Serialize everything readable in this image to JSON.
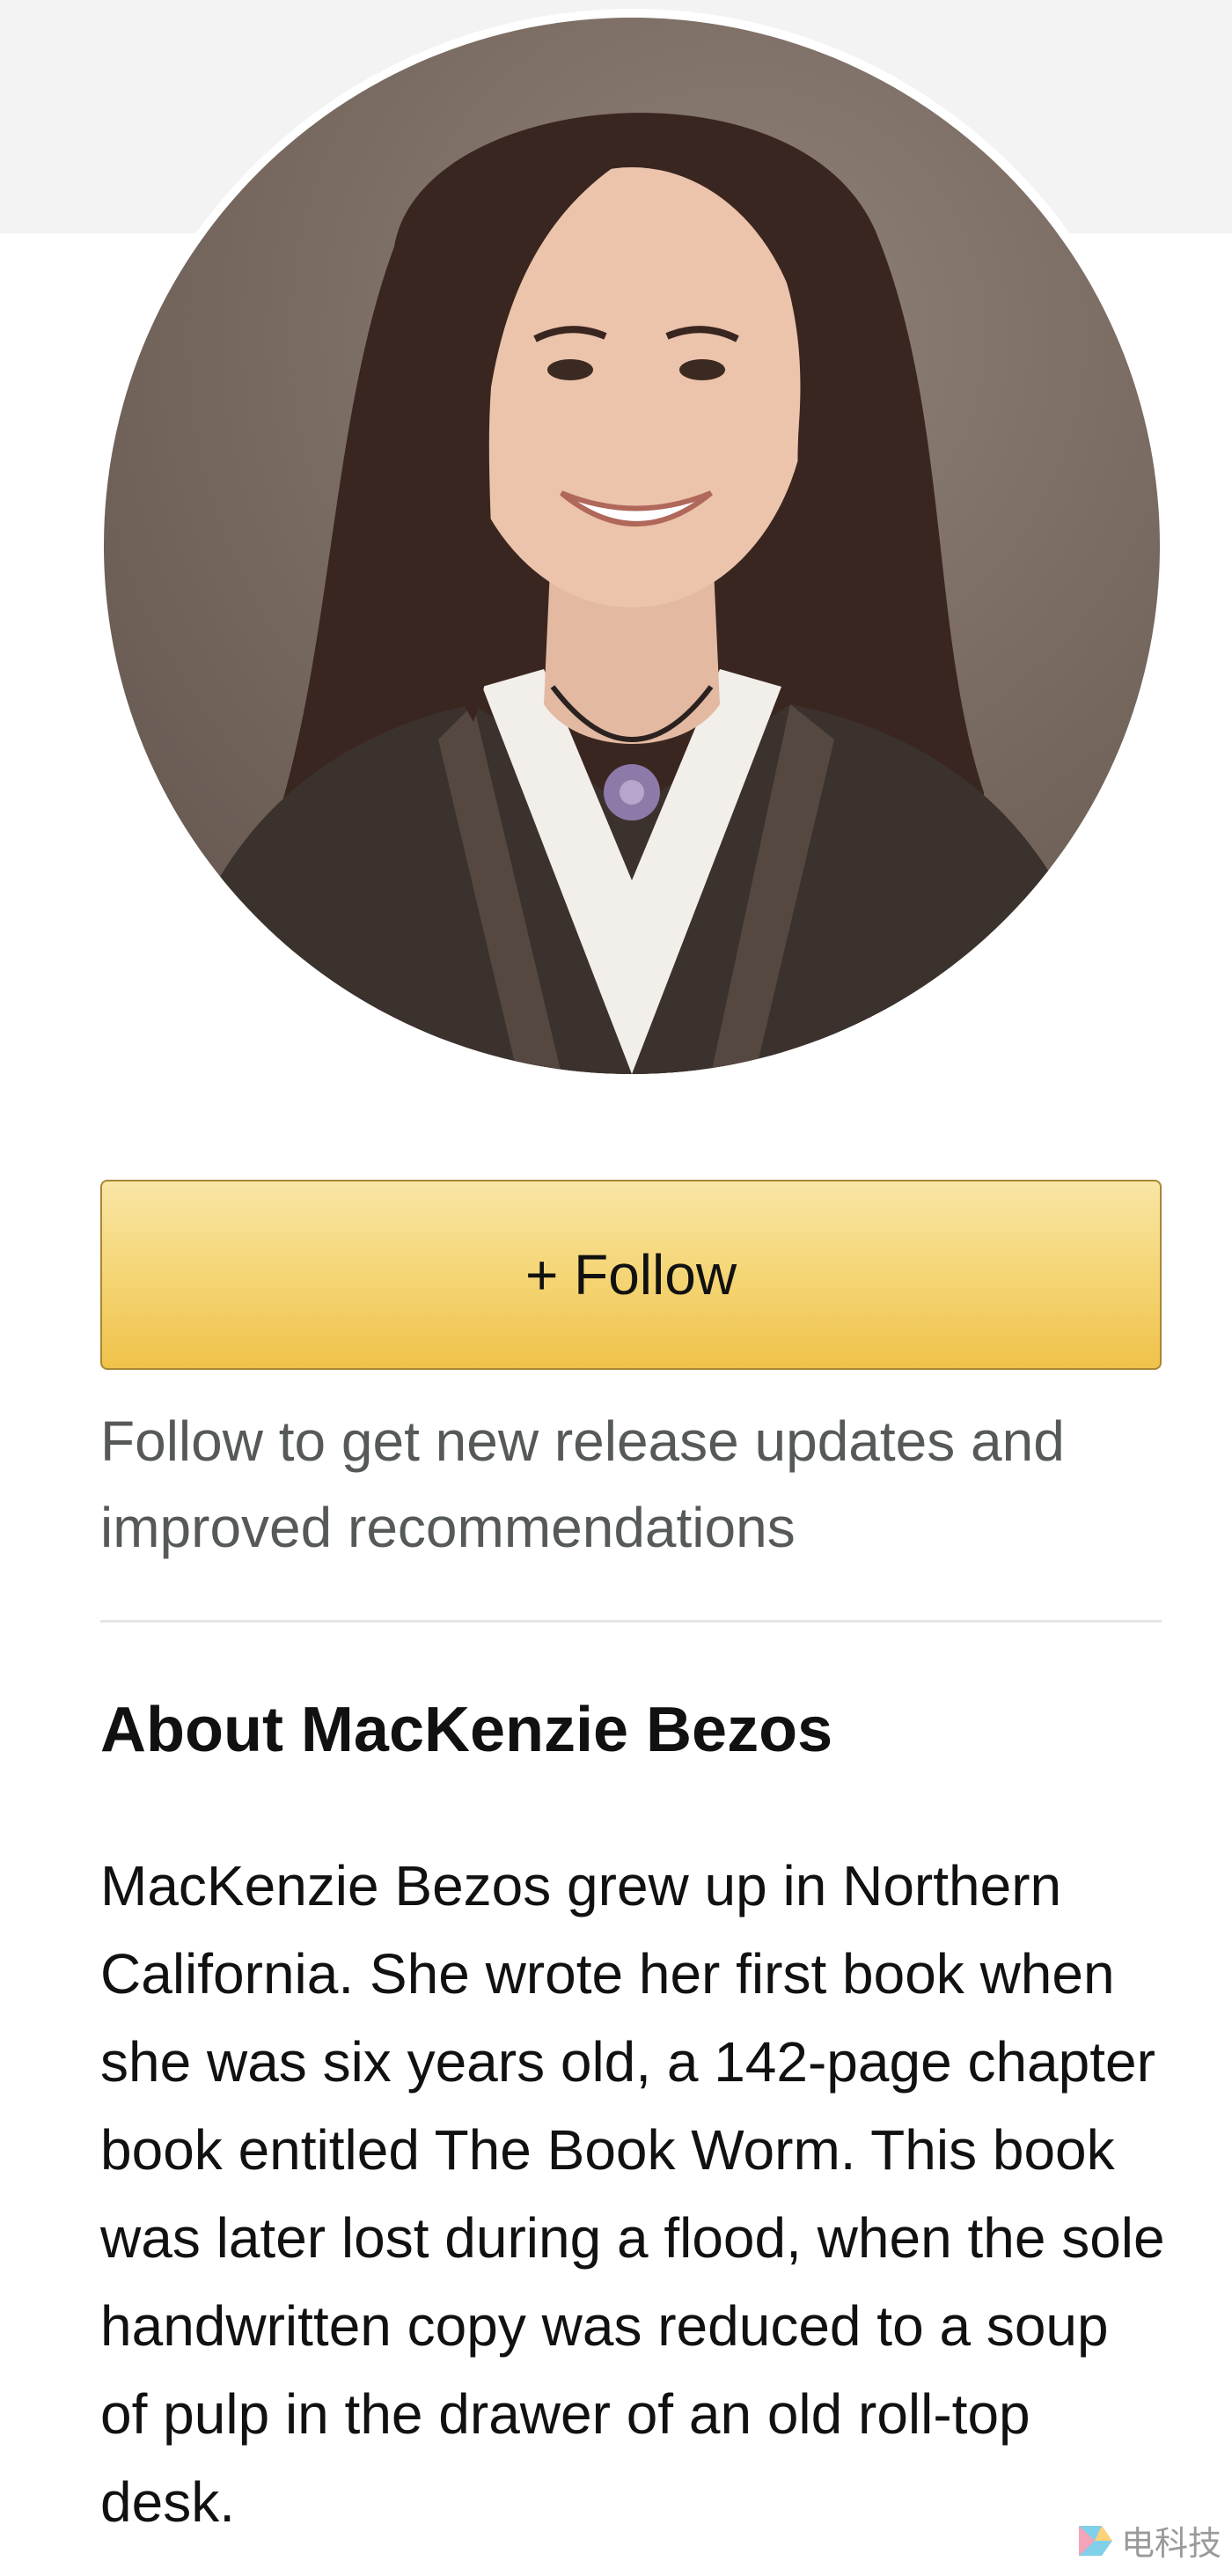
{
  "author": {
    "name": "MacKenzie Bezos",
    "photo_alt": "MacKenzie Bezos"
  },
  "follow": {
    "button_label": "+ Follow",
    "hint": "Follow to get new release updates and improved recommendations"
  },
  "about": {
    "heading": "About MacKenzie Bezos",
    "bio": "MacKenzie Bezos grew up in Northern California. She wrote her first book when she was six years old, a 142-page chapter book entitled The Book Worm. This book was later lost during a flood, when the sole handwritten copy was reduced to a soup of pulp in the drawer of an old roll-top desk."
  },
  "watermark": {
    "text": "电科技"
  },
  "colors": {
    "button_top": "#f9e6a6",
    "button_bottom": "#efc24a",
    "button_border": "#a88734",
    "hint_text": "#565959",
    "divider": "#e3e6e6",
    "top_band": "#f3f3f3"
  }
}
